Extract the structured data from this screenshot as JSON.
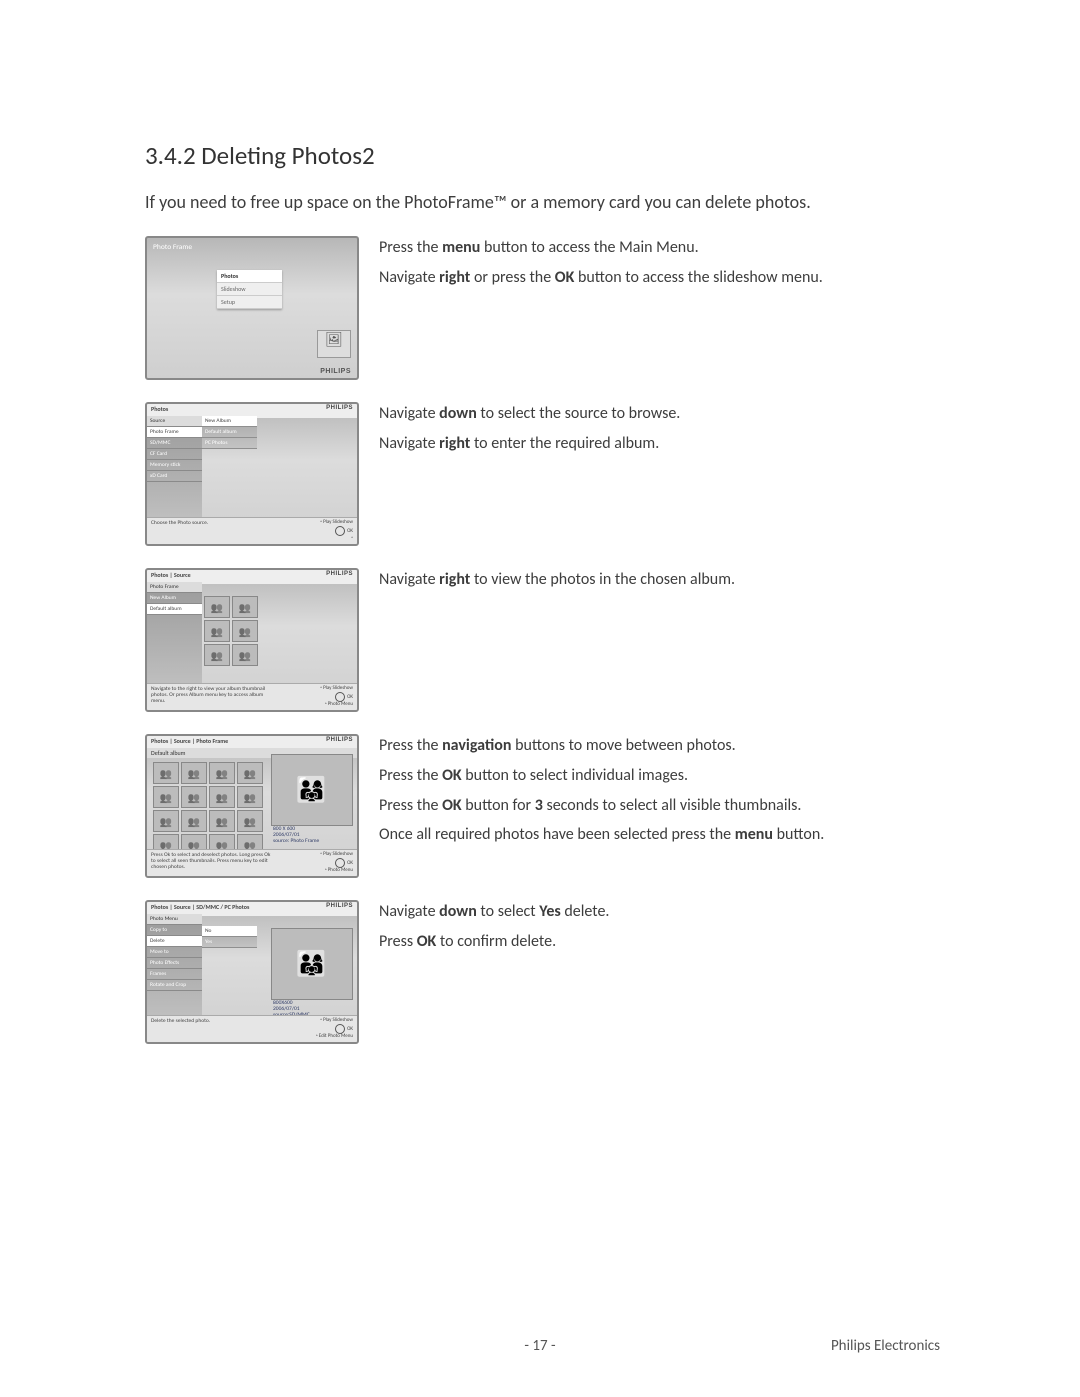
{
  "section_number": "3.4.2",
  "section_title": "Deleting Photos2",
  "intro": "If you need to free up space on the PhotoFrame™ or a memory card you can delete photos.",
  "brand": "PHILIPS",
  "steps": [
    {
      "lines": [
        {
          "segments": [
            {
              "t": "Press the "
            },
            {
              "t": "menu",
              "b": true
            },
            {
              "t": " button to access the Main Menu."
            }
          ]
        },
        {
          "segments": [
            {
              "t": "Navigate "
            },
            {
              "t": "right",
              "b": true
            },
            {
              "t": " or press the "
            },
            {
              "t": "OK",
              "b": true
            },
            {
              "t": " button to access the slideshow menu."
            }
          ]
        }
      ]
    },
    {
      "lines": [
        {
          "segments": [
            {
              "t": "Navigate "
            },
            {
              "t": "down",
              "b": true
            },
            {
              "t": " to select the source to browse."
            }
          ]
        },
        {
          "segments": [
            {
              "t": "Navigate "
            },
            {
              "t": "right",
              "b": true
            },
            {
              "t": " to enter the required album."
            }
          ]
        }
      ]
    },
    {
      "lines": [
        {
          "segments": [
            {
              "t": "Navigate "
            },
            {
              "t": "right",
              "b": true
            },
            {
              "t": " to view the photos in the chosen album."
            }
          ]
        }
      ]
    },
    {
      "lines": [
        {
          "segments": [
            {
              "t": "Press the "
            },
            {
              "t": "navigation",
              "b": true
            },
            {
              "t": " buttons to move between photos."
            }
          ]
        },
        {
          "segments": [
            {
              "t": "Press the "
            },
            {
              "t": "OK",
              "b": true
            },
            {
              "t": " button to select individual images."
            }
          ]
        },
        {
          "segments": [
            {
              "t": "Press the "
            },
            {
              "t": "OK",
              "b": true
            },
            {
              "t": " button for "
            },
            {
              "t": "3",
              "b": true
            },
            {
              "t": " seconds to select all visible thumbnails."
            }
          ]
        },
        {
          "segments": [
            {
              "t": "Once all required photos have been selected press the "
            },
            {
              "t": "menu",
              "b": true
            },
            {
              "t": " button."
            }
          ]
        }
      ]
    },
    {
      "lines": [
        {
          "segments": [
            {
              "t": "Navigate "
            },
            {
              "t": "down",
              "b": true
            },
            {
              "t": " to select "
            },
            {
              "t": "Yes",
              "b": true
            },
            {
              "t": " delete."
            }
          ]
        },
        {
          "segments": [
            {
              "t": "Press "
            },
            {
              "t": "OK",
              "b": true
            },
            {
              "t": " to confirm delete."
            }
          ]
        }
      ]
    }
  ],
  "shot1": {
    "title": "Photo Frame",
    "menu": [
      "Photos",
      "Slideshow",
      "Setup"
    ]
  },
  "shot2": {
    "breadcrumb": "Photos",
    "header": "Source",
    "left": [
      "Photo Frame",
      "SD/MMC",
      "CF Card",
      "Memory stick",
      "xD Card"
    ],
    "right": [
      "New Album",
      "Default album",
      "PC Photos"
    ],
    "hint": "Choose the Photo source.",
    "legend": [
      "Play Slideshow",
      "OK",
      ""
    ]
  },
  "shot3": {
    "breadcrumb": "Photos | Source",
    "header": "Photo Frame",
    "left": [
      "New Album",
      "Default album"
    ],
    "hint": "Navigate to the right to view your album thumbnail photos. Or press Album menu key to access album menu.",
    "legend": [
      "Play Slideshow",
      "OK",
      "Photo Menu"
    ]
  },
  "shot4": {
    "breadcrumb": "Photos | Source | Photo Frame",
    "header": "Default album",
    "meta": [
      "800 X 600",
      "2006/07/01",
      "source: Photo Frame"
    ],
    "hint": "Press Ok to select and deselect photos. Long press Ok to select all seen thumbnails. Press menu key to edit chosen photos.",
    "legend": [
      "Play Slideshow",
      "OK",
      "Photo Menu"
    ]
  },
  "shot5": {
    "breadcrumb": "Photos | Source | SD/MMC / PC Photos",
    "header": "Photo Menu",
    "left": [
      "Copy to",
      "Delete",
      "Move to",
      "Photo Effects",
      "Frames",
      "Rotate and Crop"
    ],
    "right": [
      "No",
      "Yes"
    ],
    "meta": [
      "800X600",
      "2006/07/01",
      "source:SD/MMC"
    ],
    "hint": "Delete the selected photo.",
    "legend": [
      "Play Slideshow",
      "OK",
      "Edit Photo Menu"
    ]
  },
  "footer": {
    "page": "- 17 -",
    "company": "Philips Electronics"
  }
}
